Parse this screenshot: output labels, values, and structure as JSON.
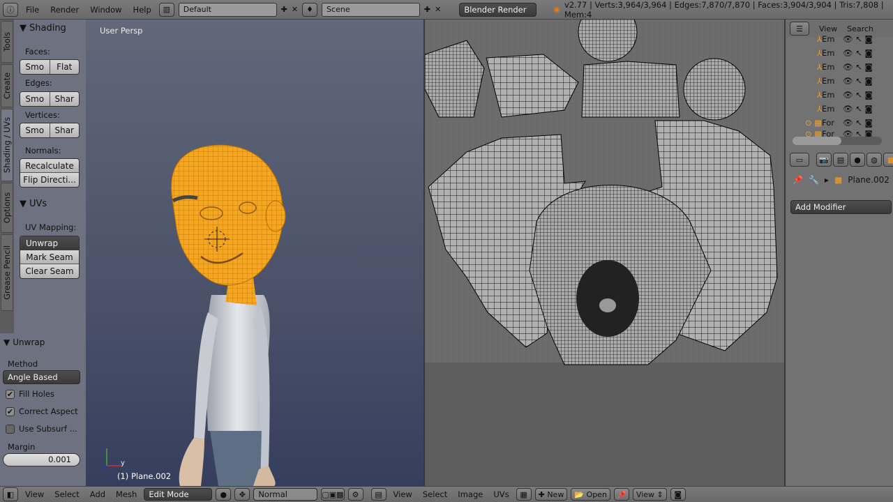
{
  "topbar": {
    "menus": [
      "File",
      "Render",
      "Window",
      "Help"
    ],
    "layout": "Default",
    "scene": "Scene",
    "engine": "Blender Render",
    "info": "v2.77 | Verts:3,964/3,964 | Edges:7,870/7,870 | Faces:3,904/3,904 | Tris:7,808 | Mem:4"
  },
  "tabs": [
    "Tools",
    "Create",
    "Shading / UVs",
    "Options",
    "Grease Pencil"
  ],
  "shading": {
    "title": "Shading",
    "faces": "Faces:",
    "faces_btns": [
      "Smo",
      "Flat"
    ],
    "edges": "Edges:",
    "edges_btns": [
      "Smo",
      "Shar"
    ],
    "vertices": "Vertices:",
    "vertices_btns": [
      "Smo",
      "Shar"
    ],
    "normals": "Normals:",
    "recalc": "Recalculate",
    "flip": "Flip Directi..."
  },
  "uvs": {
    "title": "UVs",
    "mapping": "UV Mapping:",
    "unwrap": "Unwrap",
    "mark": "Mark Seam",
    "clear": "Clear Seam"
  },
  "unwrap": {
    "title": "Unwrap",
    "method_label": "Method",
    "method": "Angle Based",
    "fill_holes": "Fill Holes",
    "fill_holes_checked": true,
    "correct_aspect": "Correct Aspect",
    "correct_aspect_checked": true,
    "use_subsurf": "Use Subsurf ...",
    "use_subsurf_checked": false,
    "margin_label": "Margin",
    "margin": "0.001"
  },
  "viewport": {
    "label": "User Persp",
    "object": "(1) Plane.002",
    "axis_y": "y"
  },
  "outliner": {
    "menus": [
      "View",
      "Search"
    ],
    "items": [
      "Em",
      "Em",
      "Em",
      "Em",
      "Em",
      "Em",
      "For",
      "For"
    ]
  },
  "properties": {
    "object": "Plane.002",
    "add_modifier": "Add Modifier"
  },
  "bottom3d": {
    "menus": [
      "View",
      "Select",
      "Add",
      "Mesh"
    ],
    "mode": "Edit Mode",
    "pivot": "Normal"
  },
  "bottomuv": {
    "menus": [
      "View",
      "Select",
      "Image",
      "UVs"
    ],
    "new": "New",
    "open": "Open",
    "view": "View"
  },
  "colors": {
    "mesh": "#f5a623",
    "viewport_top": "#62687a",
    "viewport_bottom": "#363e5e"
  }
}
